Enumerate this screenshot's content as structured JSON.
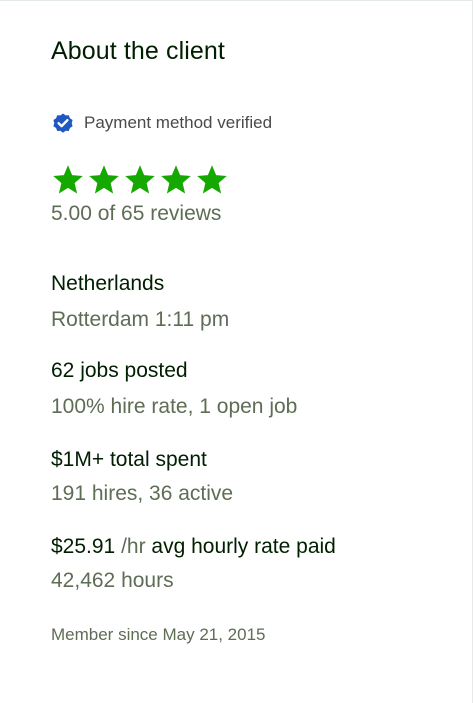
{
  "client": {
    "title": "About the client",
    "payment_verified_label": "Payment method verified",
    "rating": {
      "value": 5.0,
      "max": 5
    },
    "reviews_text": "5.00 of 65 reviews",
    "location": {
      "country": "Netherlands",
      "city_time": "Rotterdam 1:11 pm"
    },
    "jobs": {
      "posted": "62 jobs posted",
      "hire_rate": "100% hire rate, 1 open job"
    },
    "spend": {
      "total": "$1M+ total spent",
      "hires": "191 hires, 36 active"
    },
    "hourly": {
      "amount": "$25.91",
      "unit": " /hr",
      "label": " avg hourly rate paid",
      "hours": "42,462 hours"
    },
    "member_since": "Member since May 21, 2015"
  },
  "colors": {
    "verified_badge": "#1f57c3",
    "star": "#14a800",
    "primary_text": "#001e00",
    "secondary_text": "#5e6d55"
  }
}
